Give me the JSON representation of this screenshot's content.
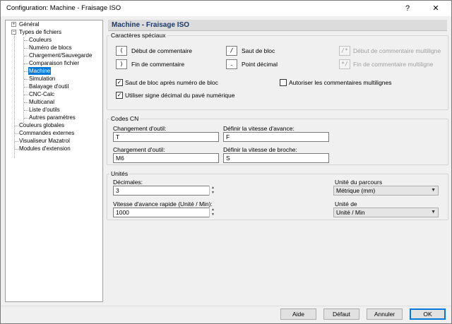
{
  "window": {
    "title": "Configuration: Machine - Fraisage ISO",
    "help_glyph": "?",
    "close_glyph": "✕"
  },
  "tree": {
    "items": [
      {
        "label": "Général",
        "expander": "+"
      },
      {
        "label": "Types de fichiers",
        "expander": "−"
      },
      {
        "label": "Couleurs"
      },
      {
        "label": "Numéro de blocs"
      },
      {
        "label": "Chargement/Sauvegarde"
      },
      {
        "label": "Comparaison fichier"
      },
      {
        "label": "Machine",
        "selected": true
      },
      {
        "label": "Simulation"
      },
      {
        "label": "Balayage d'outil"
      },
      {
        "label": "CNC-Calc"
      },
      {
        "label": "Multicanal"
      },
      {
        "label": "Liste d'outils"
      },
      {
        "label": "Autres paramètres"
      },
      {
        "label": "Couleurs globales"
      },
      {
        "label": "Commandes externes"
      },
      {
        "label": "Visualiseur Mazatrol"
      },
      {
        "label": "Modules d'extension"
      }
    ]
  },
  "header": {
    "title": "Machine - Fraisage ISO"
  },
  "special_chars": {
    "title": "Caractères spéciaux",
    "comment_start": {
      "key": "(",
      "label": "Début de commentaire"
    },
    "comment_end": {
      "key": ")",
      "label": "Fin de commentaire"
    },
    "block_skip": {
      "key": "/",
      "label": "Saut de bloc"
    },
    "decimal_point": {
      "key": ".",
      "label": "Point décimal"
    },
    "multiline_start": {
      "key": "/*",
      "label": "Début de commentaire multiligne"
    },
    "multiline_end": {
      "key": "*/",
      "label": "Fin de commentaire multiligne"
    },
    "cb_block_skip_after_number": {
      "label": "Saut de bloc après numéro de bloc",
      "checked": true
    },
    "cb_allow_multiline": {
      "label": "Autoriser les commentaires multilignes",
      "checked": false
    },
    "cb_numpad_decimal": {
      "label": "Utiliser signe décimal du pavé numérique",
      "checked": true
    }
  },
  "cn_codes": {
    "title": "Codes CN",
    "tool_change": {
      "label": "Changement d'outil:",
      "value": "T"
    },
    "feed_rate": {
      "label": "Définir la vitesse d'avance:",
      "value": "F"
    },
    "tool_load": {
      "label": "Chargement d'outil:",
      "value": "M6"
    },
    "spindle_speed": {
      "label": "Définir la vitesse de broche:",
      "value": "S"
    }
  },
  "units": {
    "title": "Unités",
    "decimals": {
      "label": "Décimales:",
      "value": "3"
    },
    "rapid_feed": {
      "label": "Vitesse d'avance rapide (Unité / Min):",
      "value": "1000"
    },
    "path_unit": {
      "label": "Unité du parcours",
      "value": "Métrique (mm)"
    },
    "unit_of": {
      "label": "Unité de",
      "value": "Unité / Min"
    }
  },
  "buttons": {
    "help": "Aide",
    "default": "Défaut",
    "cancel": "Annuler",
    "ok": "OK"
  },
  "glyphs": {
    "check": "✓",
    "spin_up": "▲",
    "spin_down": "▼",
    "dropdown": "▼"
  }
}
